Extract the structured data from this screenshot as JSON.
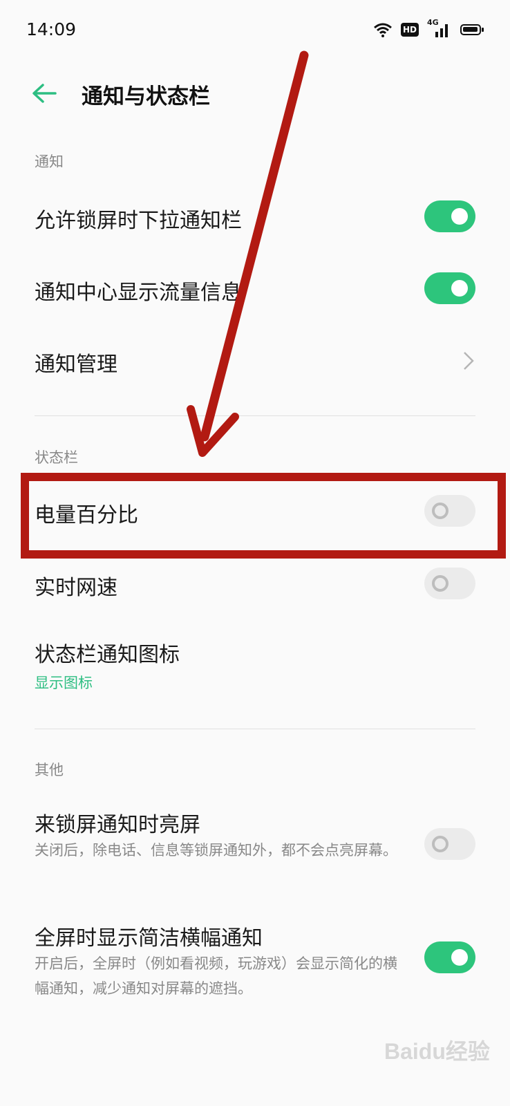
{
  "status_bar": {
    "time": "14:09",
    "hd_label": "HD",
    "network_label": "4G",
    "icons": [
      "wifi-icon",
      "hd-icon",
      "signal-icon",
      "battery-icon"
    ]
  },
  "header": {
    "back_icon": "arrow-left-icon",
    "title": "通知与状态栏"
  },
  "sections": {
    "notifications": {
      "label": "通知",
      "items": [
        {
          "title": "允许锁屏时下拉通知栏",
          "toggle": true
        },
        {
          "title": "通知中心显示流量信息",
          "toggle": true
        },
        {
          "title": "通知管理",
          "chevron": true
        }
      ]
    },
    "status_bar": {
      "label": "状态栏",
      "items": [
        {
          "title": "电量百分比",
          "toggle": false
        },
        {
          "title": "实时网速",
          "toggle": false
        },
        {
          "title": "状态栏通知图标",
          "subtitle": "显示图标"
        }
      ]
    },
    "other": {
      "label": "其他",
      "items": [
        {
          "title": "来锁屏通知时亮屏",
          "subtitle": "关闭后，除电话、信息等锁屏通知外，都不会点亮屏幕。",
          "toggle": false
        },
        {
          "title": "全屏时显示简洁横幅通知",
          "subtitle": "开启后，全屏时（例如看视频，玩游戏）会显示简化的横幅通知，减少通知对屏幕的遮挡。",
          "toggle": true
        }
      ]
    }
  },
  "colors": {
    "toggle_on": "#2dc57c",
    "accent_text": "#2dbe82",
    "annotation": "#b21a12"
  },
  "watermark": "Baidu经验"
}
